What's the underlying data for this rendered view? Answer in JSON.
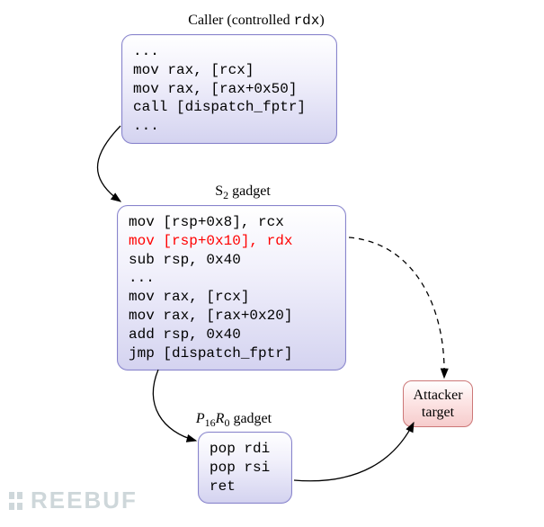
{
  "labels": {
    "caller_prefix": "Caller (controlled ",
    "caller_reg": "rdx",
    "caller_suffix": ")",
    "s2_prefix": "S",
    "s2_sub": "2",
    "s2_suffix": " gadget",
    "pr_p": "P",
    "pr_p_sub": "16",
    "pr_r": "R",
    "pr_r_sub": "0",
    "pr_suffix": " gadget",
    "target_line1": "Attacker",
    "target_line2": "target"
  },
  "caller": {
    "l0": "...",
    "l1": "mov rax, [rcx]",
    "l2": "mov rax, [rax+0x50]",
    "l3": "call [dispatch_fptr]",
    "l4": "..."
  },
  "s2": {
    "l0": "mov [rsp+0x8], rcx",
    "l1": "mov [rsp+0x10], rdx",
    "l2": "sub rsp, 0x40",
    "l3": "...",
    "l4": "mov rax, [rcx]",
    "l5": "mov rax, [rax+0x20]",
    "l6": "add rsp, 0x40",
    "l7": "jmp [dispatch_fptr]"
  },
  "pr": {
    "l0": "pop rdi",
    "l1": "pop rsi",
    "l2": "ret"
  },
  "watermark": "REEBUF"
}
